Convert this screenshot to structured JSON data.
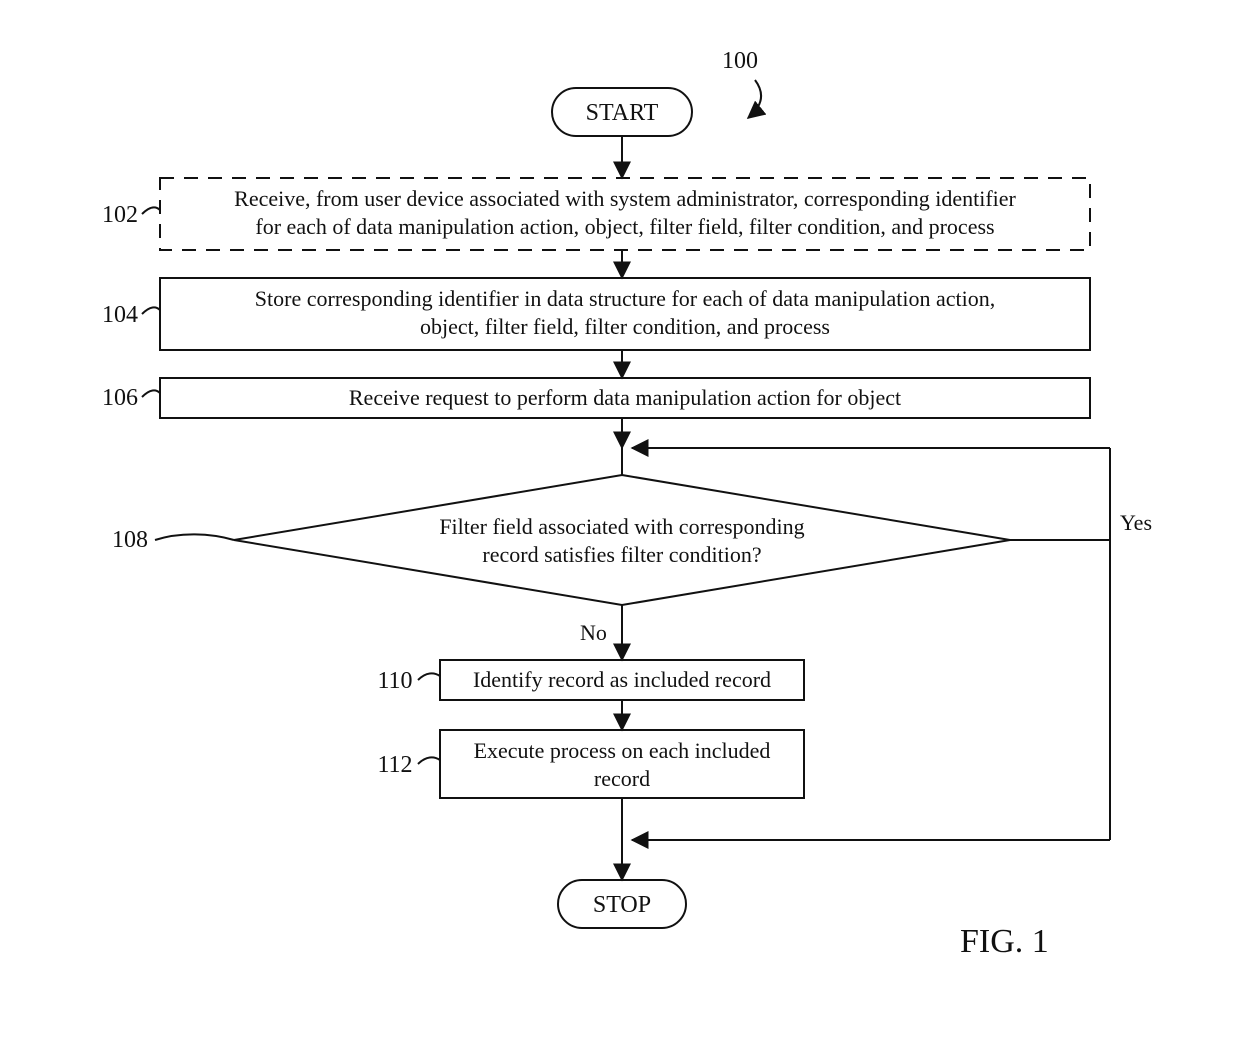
{
  "diagram_ref": "100",
  "figure_label": "FIG. 1",
  "terminals": {
    "start": "START",
    "stop": "STOP"
  },
  "steps": {
    "s102": {
      "ref": "102",
      "lines": [
        "Receive, from user device associated with system administrator, corresponding identifier",
        "for each of data manipulation action, object, filter field, filter condition, and process"
      ]
    },
    "s104": {
      "ref": "104",
      "lines": [
        "Store corresponding identifier in data structure for each of data manipulation action,",
        "object, filter field, filter condition, and process"
      ]
    },
    "s106": {
      "ref": "106",
      "text": "Receive request to perform data manipulation action for object"
    },
    "s108": {
      "ref": "108",
      "lines": [
        "Filter field associated with corresponding",
        "record satisfies filter condition?"
      ]
    },
    "s110": {
      "ref": "110",
      "text": "Identify record as included record"
    },
    "s112": {
      "ref": "112",
      "lines": [
        "Execute process on each included",
        "record"
      ]
    }
  },
  "edge_labels": {
    "no": "No",
    "yes": "Yes"
  }
}
